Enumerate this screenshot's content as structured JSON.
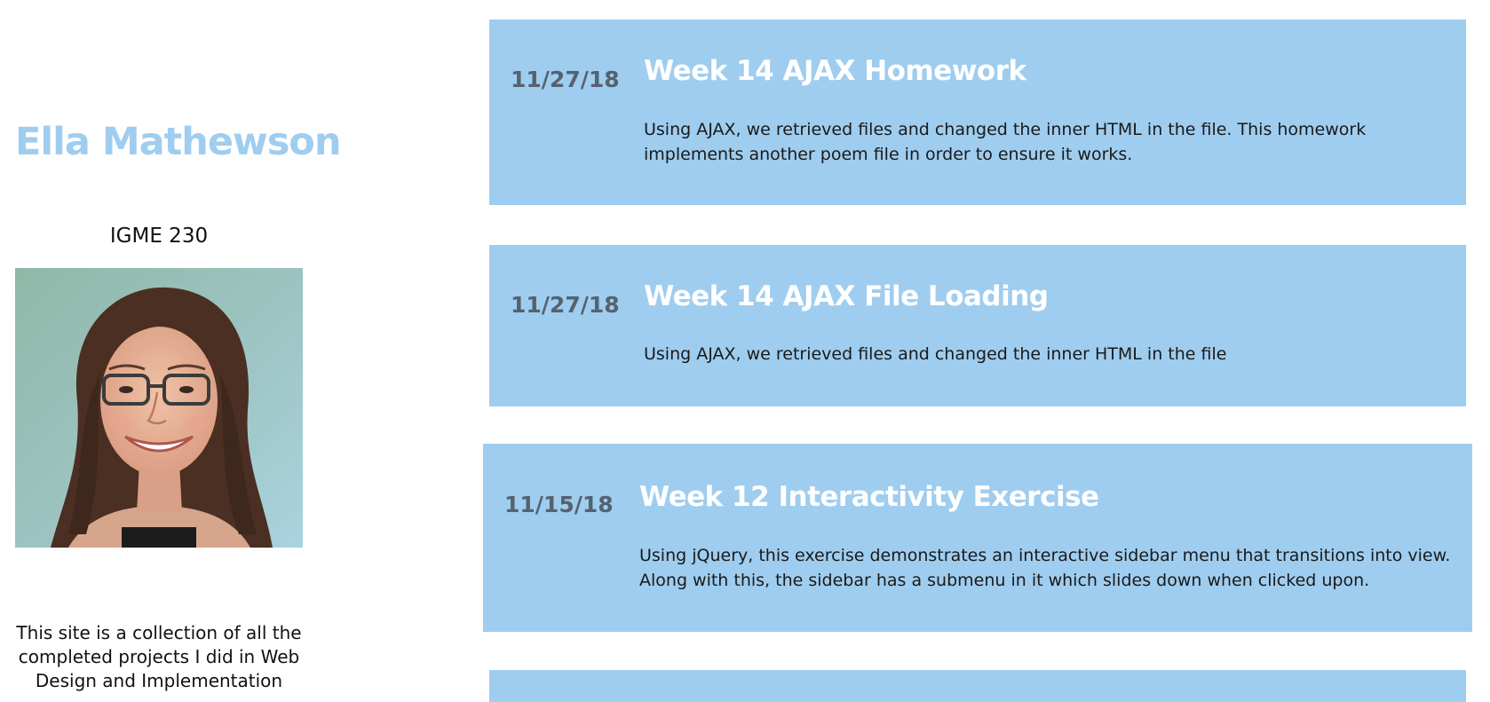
{
  "sidebar": {
    "name": "Ella Mathewson",
    "course": "IGME 230",
    "portrait_icon": "portrait-photo",
    "blurb": "This site is a collection of all the completed projects I did in Web Design and Implementation"
  },
  "entries": [
    {
      "date": "11/27/18",
      "title": "Week 14 AJAX Homework",
      "description": "Using AJAX, we retrieved files and changed the inner HTML in the file. This homework implements another poem file in order to ensure it works."
    },
    {
      "date": "11/27/18",
      "title": "Week 14 AJAX File Loading",
      "description": "Using AJAX, we retrieved files and changed the inner HTML in the file"
    },
    {
      "date": "11/15/18",
      "title": "Week 12 Interactivity Exercise",
      "description": "Using jQuery, this exercise demonstrates an interactive sidebar menu that transitions into view. Along with this, the sidebar has a submenu in it which slides down when clicked upon."
    }
  ],
  "colors": {
    "accent": "#9fcdef",
    "date_text": "#556270",
    "title_text": "#ffffff",
    "body_text": "#1a1a1a"
  }
}
